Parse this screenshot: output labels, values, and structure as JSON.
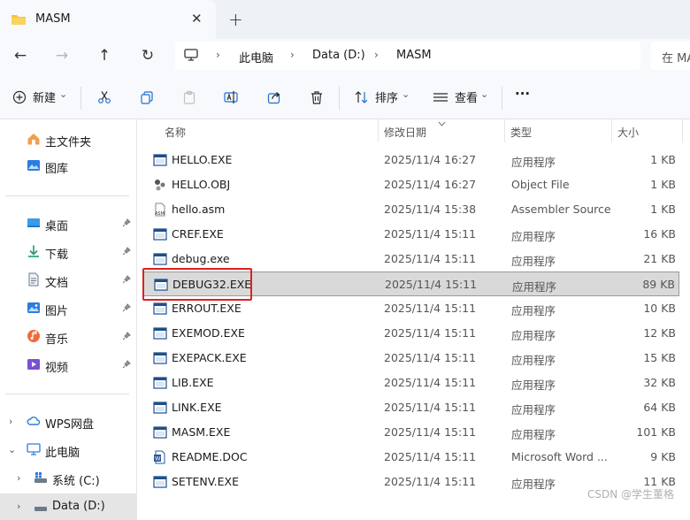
{
  "window": {
    "tab_title": "MASM",
    "close_symbol": "✕",
    "new_tab_symbol": "+"
  },
  "nav": {
    "back": "←",
    "forward": "→",
    "up": "↑",
    "refresh": "↻",
    "breadcrumb": [
      "此电脑",
      "Data (D:)",
      "MASM"
    ],
    "separator": "›",
    "search_placeholder": "在 MA"
  },
  "commands": {
    "new_label": "新建",
    "sort_label": "排序",
    "view_label": "查看",
    "more": "···",
    "dropdown": "⌄"
  },
  "sidebar": {
    "quick": [
      {
        "label": "主文件夹",
        "icon": "home-icon"
      },
      {
        "label": "图库",
        "icon": "gallery-icon"
      }
    ],
    "pinned": [
      {
        "label": "桌面",
        "icon": "desktop-icon"
      },
      {
        "label": "下载",
        "icon": "download-icon"
      },
      {
        "label": "文档",
        "icon": "document-icon"
      },
      {
        "label": "图片",
        "icon": "picture-icon"
      },
      {
        "label": "音乐",
        "icon": "music-icon"
      },
      {
        "label": "视频",
        "icon": "video-icon"
      }
    ],
    "tree": [
      {
        "label": "WPS网盘",
        "icon": "cloud-icon",
        "chevron": "›"
      },
      {
        "label": "此电脑",
        "icon": "pc-icon",
        "chevron": "⌄"
      },
      {
        "label": "系统 (C:)",
        "icon": "drive-icon",
        "chevron": "›"
      },
      {
        "label": "Data (D:)",
        "icon": "drive-icon",
        "chevron": "›"
      }
    ]
  },
  "columns": {
    "name": "名称",
    "date": "修改日期",
    "type": "类型",
    "size": "大小"
  },
  "files": [
    {
      "name": "HELLO.EXE",
      "date": "2025/11/4 16:27",
      "type": "应用程序",
      "size": "1 KB",
      "icon": "exe"
    },
    {
      "name": "HELLO.OBJ",
      "date": "2025/11/4 16:27",
      "type": "Object File",
      "size": "1 KB",
      "icon": "obj"
    },
    {
      "name": "hello.asm",
      "date": "2025/11/4 15:38",
      "type": "Assembler Source",
      "size": "1 KB",
      "icon": "asm"
    },
    {
      "name": "CREF.EXE",
      "date": "2025/11/4 15:11",
      "type": "应用程序",
      "size": "16 KB",
      "icon": "exe"
    },
    {
      "name": "debug.exe",
      "date": "2025/11/4 15:11",
      "type": "应用程序",
      "size": "21 KB",
      "icon": "exe"
    },
    {
      "name": "DEBUG32.EXE",
      "date": "2025/11/4 15:11",
      "type": "应用程序",
      "size": "89 KB",
      "icon": "exe",
      "selected": true
    },
    {
      "name": "ERROUT.EXE",
      "date": "2025/11/4 15:11",
      "type": "应用程序",
      "size": "10 KB",
      "icon": "exe"
    },
    {
      "name": "EXEMOD.EXE",
      "date": "2025/11/4 15:11",
      "type": "应用程序",
      "size": "12 KB",
      "icon": "exe"
    },
    {
      "name": "EXEPACK.EXE",
      "date": "2025/11/4 15:11",
      "type": "应用程序",
      "size": "15 KB",
      "icon": "exe"
    },
    {
      "name": "LIB.EXE",
      "date": "2025/11/4 15:11",
      "type": "应用程序",
      "size": "32 KB",
      "icon": "exe"
    },
    {
      "name": "LINK.EXE",
      "date": "2025/11/4 15:11",
      "type": "应用程序",
      "size": "64 KB",
      "icon": "exe"
    },
    {
      "name": "MASM.EXE",
      "date": "2025/11/4 15:11",
      "type": "应用程序",
      "size": "101 KB",
      "icon": "exe"
    },
    {
      "name": "README.DOC",
      "date": "2025/11/4 15:11",
      "type": "Microsoft Word ...",
      "size": "9 KB",
      "icon": "doc"
    },
    {
      "name": "SETENV.EXE",
      "date": "2025/11/4 15:11",
      "type": "应用程序",
      "size": "11 KB",
      "icon": "exe"
    }
  ],
  "watermark": "CSDN @学生董格",
  "colors": {
    "accent": "#1e6fd1",
    "highlight": "#e0201f",
    "folder": "#f4c542"
  }
}
